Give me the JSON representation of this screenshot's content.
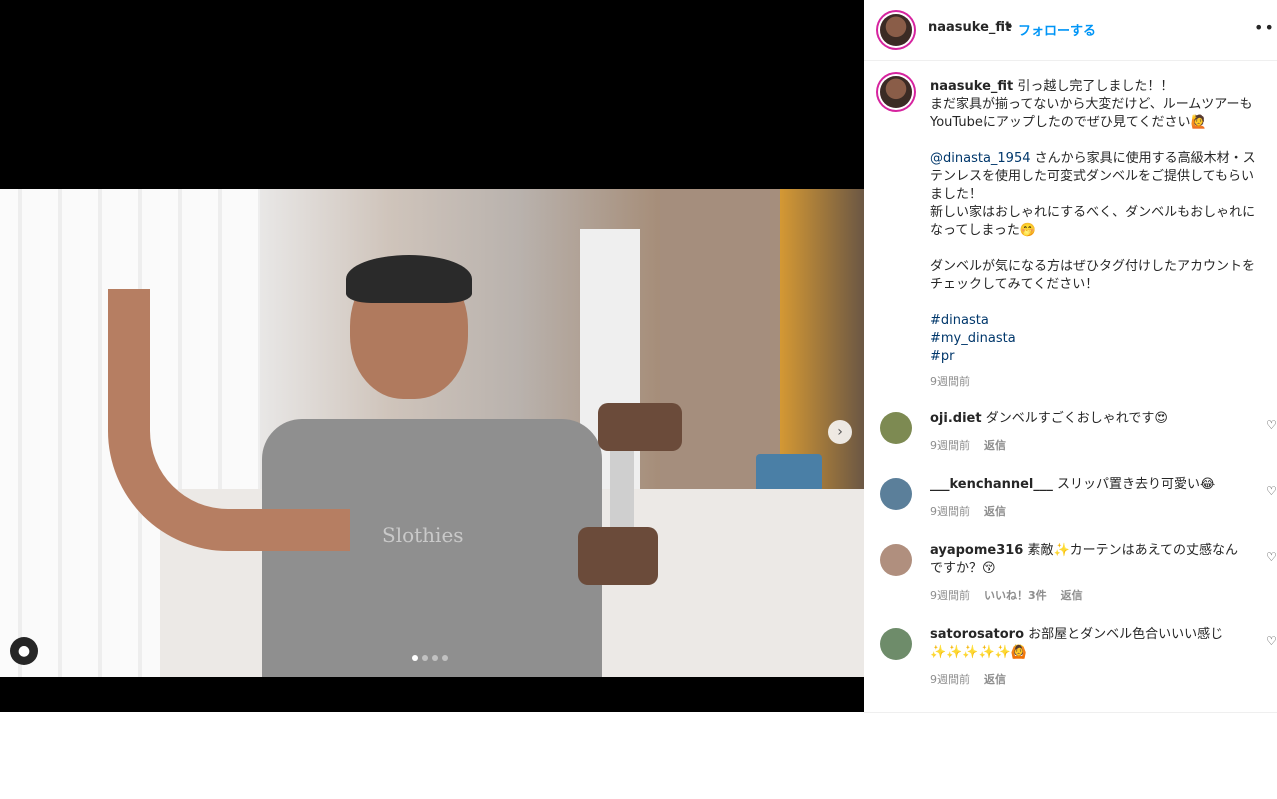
{
  "post": {
    "username": "naasuke_fit",
    "separator": "•",
    "follow_label": "フォローする",
    "more_label": "•••",
    "carousel": {
      "shirt_text": "Slothies",
      "slide_count": 4,
      "active_slide": 1
    }
  },
  "caption": {
    "username": "naasuke_fit",
    "line1": "引っ越し完了しました！！",
    "line2": "まだ家具が揃ってないから大変だけど、ルームツアーもYouTubeにアップしたのでぜひ見てください🙋",
    "mention": "@dinasta_1954",
    "line3": "さんから家具に使用する高級木材・ステンレスを使用した可変式ダンベルをご提供してもらいました！",
    "line4": "新しい家はおしゃれにするべく、ダンベルもおしゃれになってしまった🤭",
    "line5": "ダンベルが気になる方はぜひタグ付けしたアカウントをチェックしてみてください！",
    "hashtags": [
      "#dinasta",
      "#my_dinasta",
      "#pr"
    ],
    "time": "9週間前"
  },
  "comments": [
    {
      "user": "oji.diet",
      "text": "ダンベルすごくおしゃれです😍",
      "time": "9週間前",
      "likes": "",
      "reply": "返信",
      "avatar_color": "#7d8a52"
    },
    {
      "user": "___kenchannel___",
      "text": "スリッパ置き去り可愛い😂",
      "time": "9週間前",
      "likes": "",
      "reply": "返信",
      "avatar_color": "#5b7f9a"
    },
    {
      "user": "ayapome316",
      "text": "素敵✨カーテンはあえての丈感なんですか？😚",
      "time": "9週間前",
      "likes": "いいね！3件",
      "reply": "返信",
      "avatar_color": "#b08f7e"
    },
    {
      "user": "satorosatoro",
      "text": "お部屋とダンベル色合いいい感じ✨✨✨✨✨🙆",
      "time": "9週間前",
      "likes": "",
      "reply": "返信",
      "avatar_color": "#6e8c6a"
    }
  ]
}
